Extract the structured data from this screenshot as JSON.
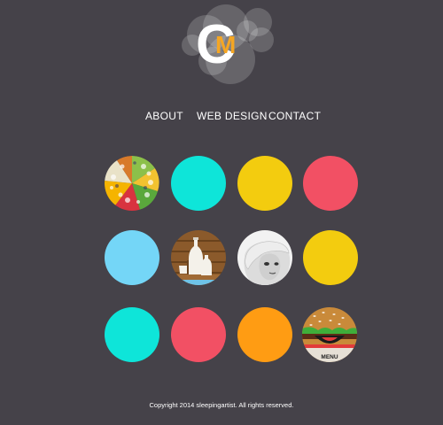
{
  "logo": {
    "letter_c": "C",
    "letter_m": "M",
    "accent": "#f5a623"
  },
  "nav": [
    {
      "label": "ABOUT"
    },
    {
      "label": "WEB DESIGN"
    },
    {
      "label": "CONTACT"
    }
  ],
  "tiles": [
    {
      "name": "tile-pattern-collage",
      "type": "image",
      "color": "#f2c230"
    },
    {
      "name": "tile-turquoise",
      "type": "solid",
      "color": "#0ee5d9"
    },
    {
      "name": "tile-yellow-1",
      "type": "solid",
      "color": "#f3cc0f"
    },
    {
      "name": "tile-coral-1",
      "type": "solid",
      "color": "#f25064"
    },
    {
      "name": "tile-light-blue",
      "type": "solid",
      "color": "#74d6f7"
    },
    {
      "name": "tile-sake-bottles",
      "type": "image",
      "color": "#8b5a2b"
    },
    {
      "name": "tile-portrait",
      "type": "image",
      "color": "#e6e6e6"
    },
    {
      "name": "tile-yellow-2",
      "type": "solid",
      "color": "#f3cc0f"
    },
    {
      "name": "tile-turquoise-2",
      "type": "solid",
      "color": "#0ee5d9"
    },
    {
      "name": "tile-coral-2",
      "type": "solid",
      "color": "#f25064"
    },
    {
      "name": "tile-orange",
      "type": "solid",
      "color": "#ff9c13"
    },
    {
      "name": "tile-burger-menu",
      "type": "image",
      "color": "#c98a3a"
    }
  ],
  "menu_label": "MENU",
  "footer": {
    "text": "Copyright 2014 sleepingartist. All rights reserved."
  }
}
